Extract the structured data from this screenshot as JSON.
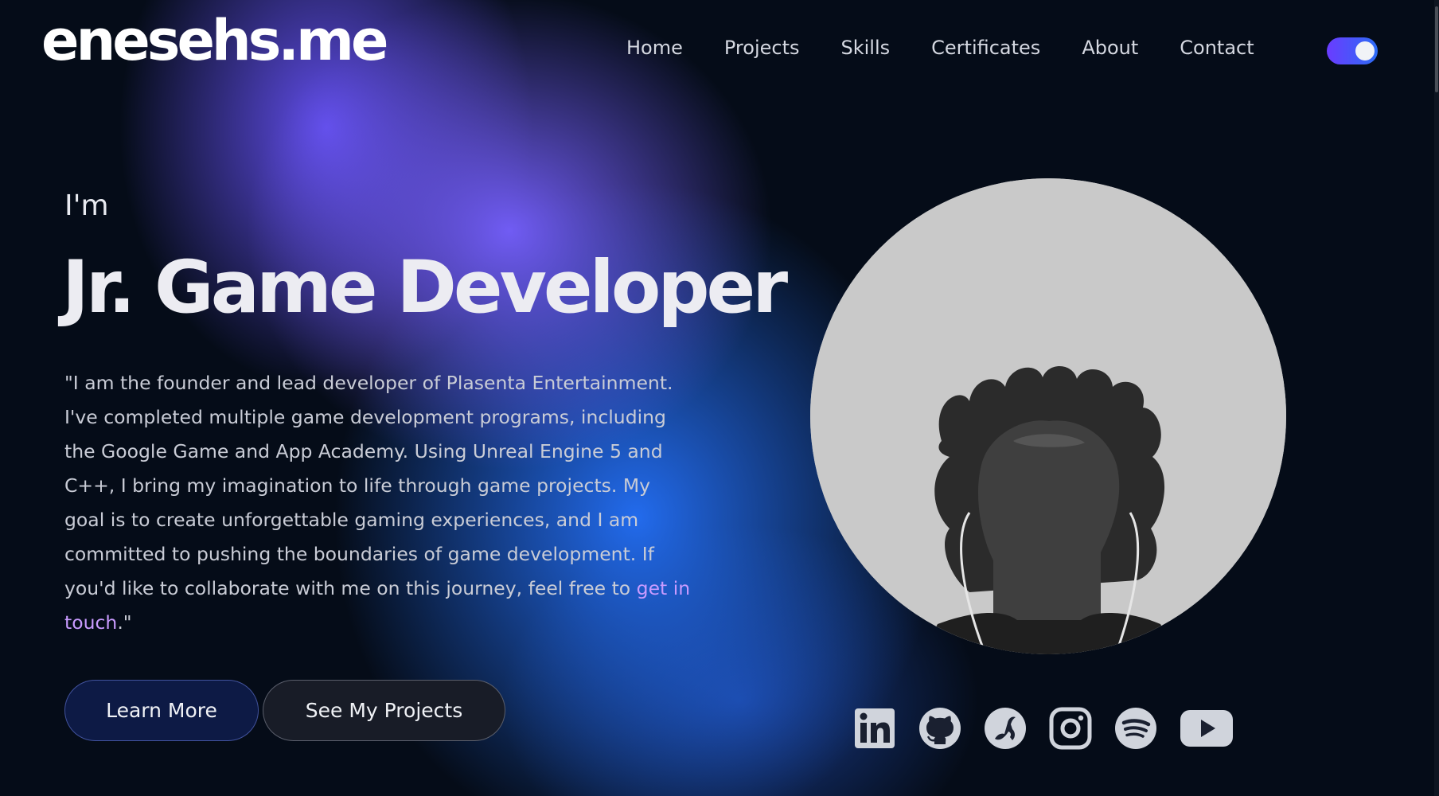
{
  "logo": {
    "text": "enesehs.me"
  },
  "nav": {
    "items": [
      {
        "label": "Home"
      },
      {
        "label": "Projects"
      },
      {
        "label": "Skills"
      },
      {
        "label": "Certificates"
      },
      {
        "label": "About"
      },
      {
        "label": "Contact"
      }
    ]
  },
  "theme_toggle": {
    "state": "on"
  },
  "hero": {
    "intro": "I'm",
    "role": "Jr. Game Developer",
    "bio_text": "\"I am the founder and lead developer of Plasenta Entertainment. I've completed multiple game development programs, including the Google Game and App Academy. Using Unreal Engine 5 and C++, I bring my imagination to life through game projects. My goal is to create unforgettable gaming experiences, and I am committed to pushing the boundaries of game development. If you'd like to collaborate with me on this journey, feel free to ",
    "bio_link": "get in touch",
    "bio_end": ".\""
  },
  "buttons": {
    "learn_more": "Learn More",
    "see_projects": "See My Projects"
  },
  "socials": [
    {
      "icon": "linkedin-icon"
    },
    {
      "icon": "github-icon"
    },
    {
      "icon": "kaggle-icon"
    },
    {
      "icon": "instagram-icon"
    },
    {
      "icon": "spotify-icon"
    },
    {
      "icon": "youtube-icon"
    }
  ],
  "colors": {
    "background": "#050c18",
    "accent_purple": "#6a54ff",
    "accent_blue": "#2470f8",
    "link": "#c99bff"
  }
}
